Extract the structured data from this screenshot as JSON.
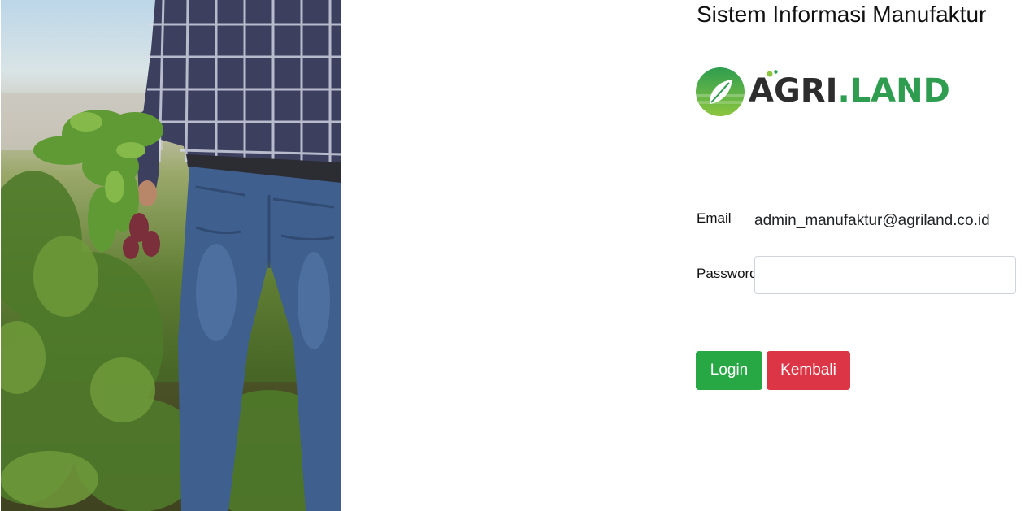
{
  "header": {
    "title": "Sistem Informasi Manufaktur"
  },
  "logo": {
    "text_dark": "AGRI",
    "text_dot": ".",
    "text_green": "LAND",
    "color_dark": "#2d2d2d",
    "color_green": "#2e9d4f"
  },
  "hero_image": {
    "description_icon": "farmer-holding-beets-photo"
  },
  "form": {
    "email_label": "Email",
    "email_value": "admin_manufaktur@agriland.co.id",
    "password_label": "Password",
    "password_value": "",
    "password_placeholder": ""
  },
  "actions": {
    "login_label": "Login",
    "login_color": "#28a745",
    "back_label": "Kembali",
    "back_color": "#dc3545"
  }
}
